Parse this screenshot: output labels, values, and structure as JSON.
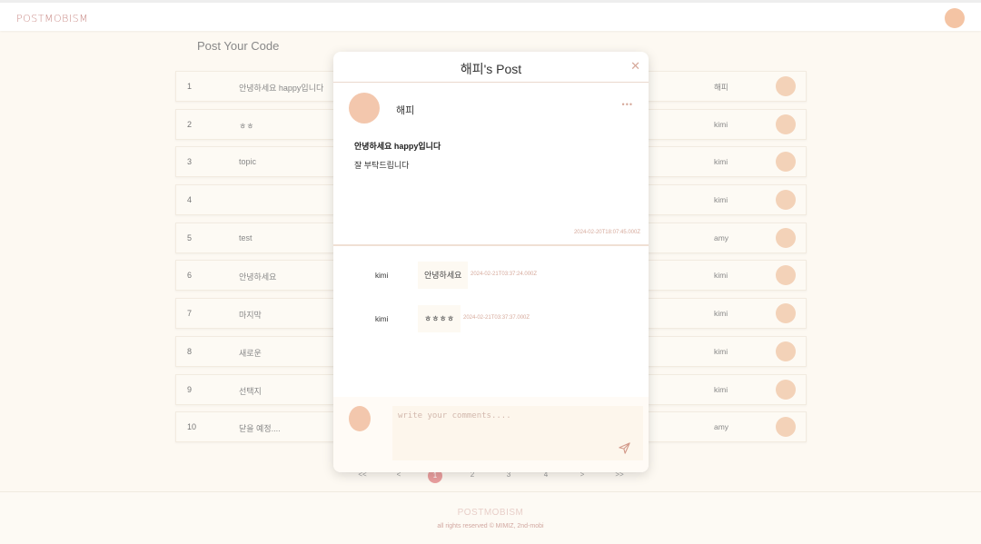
{
  "header": {
    "logo": "POSTMOBISM"
  },
  "page": {
    "title": "Post Your Code"
  },
  "posts": [
    {
      "num": "1",
      "title": "안녕하세요 happy입니다",
      "author": "해피"
    },
    {
      "num": "2",
      "title": "ㅎㅎ",
      "author": "kimi"
    },
    {
      "num": "3",
      "title": "topic",
      "author": "kimi"
    },
    {
      "num": "4",
      "title": "",
      "author": "kimi"
    },
    {
      "num": "5",
      "title": "test",
      "author": "amy"
    },
    {
      "num": "6",
      "title": "안녕하세요",
      "author": "kimi"
    },
    {
      "num": "7",
      "title": "마지막",
      "author": "kimi"
    },
    {
      "num": "8",
      "title": "새로운",
      "author": "kimi"
    },
    {
      "num": "9",
      "title": "선택지",
      "author": "kimi"
    },
    {
      "num": "10",
      "title": "닫을 예정....",
      "author": "amy"
    }
  ],
  "pagination": {
    "first": "<<",
    "prev": "<",
    "pages": [
      "1",
      "2",
      "3",
      "4"
    ],
    "next": ">",
    "last": ">>",
    "active": "1"
  },
  "modal": {
    "title": "해피's Post",
    "close": "✕",
    "author": "해피",
    "more": "•••",
    "post_title": "안녕하세요 happy입니다",
    "post_body": "잘 부탁드립니다",
    "post_date": "2024-02-20T18:07:45.000Z",
    "comments": [
      {
        "user": "kimi",
        "text": "안녕하세요",
        "date": "2024-02-21T03:37:24.000Z"
      },
      {
        "user": "kimi",
        "text": "ㅎㅎㅎㅎ",
        "date": "2024-02-21T03:37:37.000Z"
      }
    ],
    "compose_placeholder": "write your comments...."
  },
  "footer": {
    "brand": "POSTMOBISM",
    "copyright": "all rights reserved © MIMIZ, 2nd-mobi"
  },
  "colors": {
    "accent": "#e99e9e",
    "avatar": "#f3c7ad",
    "background": "#fdf9f2"
  }
}
